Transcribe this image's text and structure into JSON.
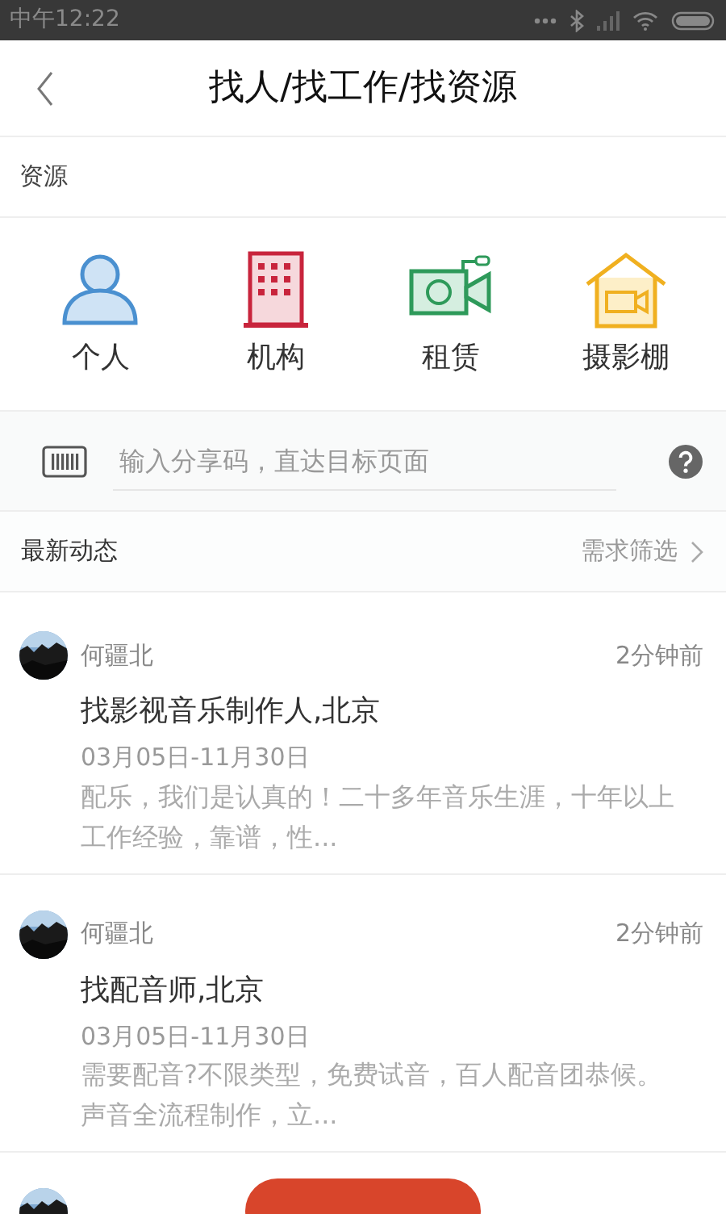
{
  "status_bar": {
    "time": "中午12:22"
  },
  "header": {
    "title": "找人/找工作/找资源"
  },
  "section_title": "资源",
  "categories": [
    {
      "label": "个人",
      "kind": "person"
    },
    {
      "label": "机构",
      "kind": "building"
    },
    {
      "label": "租赁",
      "kind": "camera"
    },
    {
      "label": "摄影棚",
      "kind": "studio"
    }
  ],
  "share_code": {
    "placeholder": "输入分享码，直达目标页面"
  },
  "feed": {
    "title": "最新动态",
    "filter": "需求筛选",
    "posts": [
      {
        "author": "何疆北",
        "time": "2分钟前",
        "title": "找影视音乐制作人,北京",
        "dates": "03月05日-11月30日",
        "description": "配乐，我们是认真的！二十多年音乐生涯，十年以上工作经验，靠谱，性..."
      },
      {
        "author": "何疆北",
        "time": "2分钟前",
        "title": "找配音师,北京",
        "dates": "03月05日-11月30日",
        "description": "需要配音?不限类型，免费试音，百人配音团恭候。声音全流程制作，立..."
      }
    ]
  }
}
